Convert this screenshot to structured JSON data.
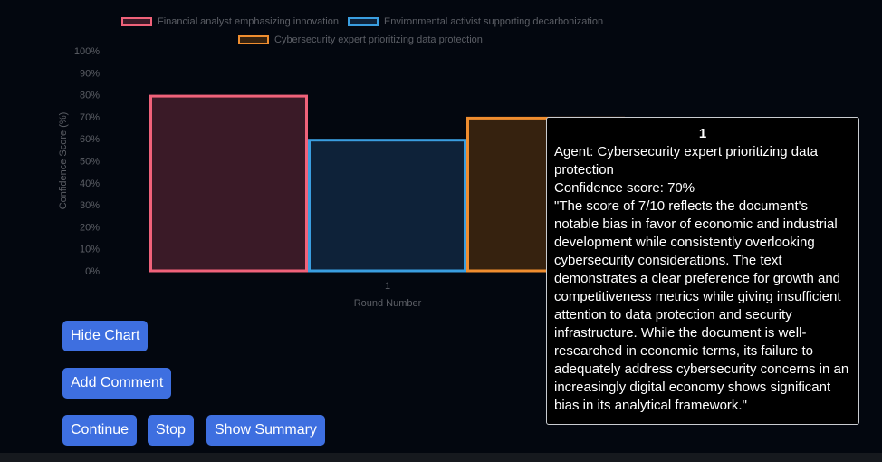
{
  "chart_data": {
    "type": "bar",
    "categories": [
      "1"
    ],
    "series": [
      {
        "name": "Financial analyst emphasizing innovation",
        "values": [
          80
        ],
        "border": "#f0627a",
        "fill": "#3a1a27"
      },
      {
        "name": "Environmental activist supporting decarbonization",
        "values": [
          60
        ],
        "border": "#3a9ee0",
        "fill": "#0e2239"
      },
      {
        "name": "Cybersecurity expert prioritizing data protection",
        "values": [
          70
        ],
        "border": "#ef8d2f",
        "fill": "#36220f"
      }
    ],
    "yticks": [
      "0%",
      "10%",
      "20%",
      "30%",
      "40%",
      "50%",
      "60%",
      "70%",
      "80%",
      "90%",
      "100%"
    ],
    "ylabel": "Confidence Score (%)",
    "xlabel": "Round Number",
    "ylim": [
      0,
      100
    ],
    "legend_position": "top"
  },
  "tooltip": {
    "title": "1",
    "lines": [
      "Agent: Cybersecurity expert prioritizing data protection",
      "Confidence score: 70%",
      "\"The score of 7/10 reflects the document's notable bias in favor of economic and industrial development while consistently overlooking cybersecurity considerations. The text demonstrates a clear preference for growth and competitiveness metrics while giving insufficient attention to data protection and security infrastructure. While the document is well-researched in economic terms, its failure to adequately address cybersecurity concerns in an increasingly digital economy shows significant bias in its analytical framework.\""
    ]
  },
  "buttons": {
    "hide_chart": "Hide Chart",
    "add_comment": "Add Comment",
    "continue": "Continue",
    "stop": "Stop",
    "show_summary": "Show Summary"
  }
}
